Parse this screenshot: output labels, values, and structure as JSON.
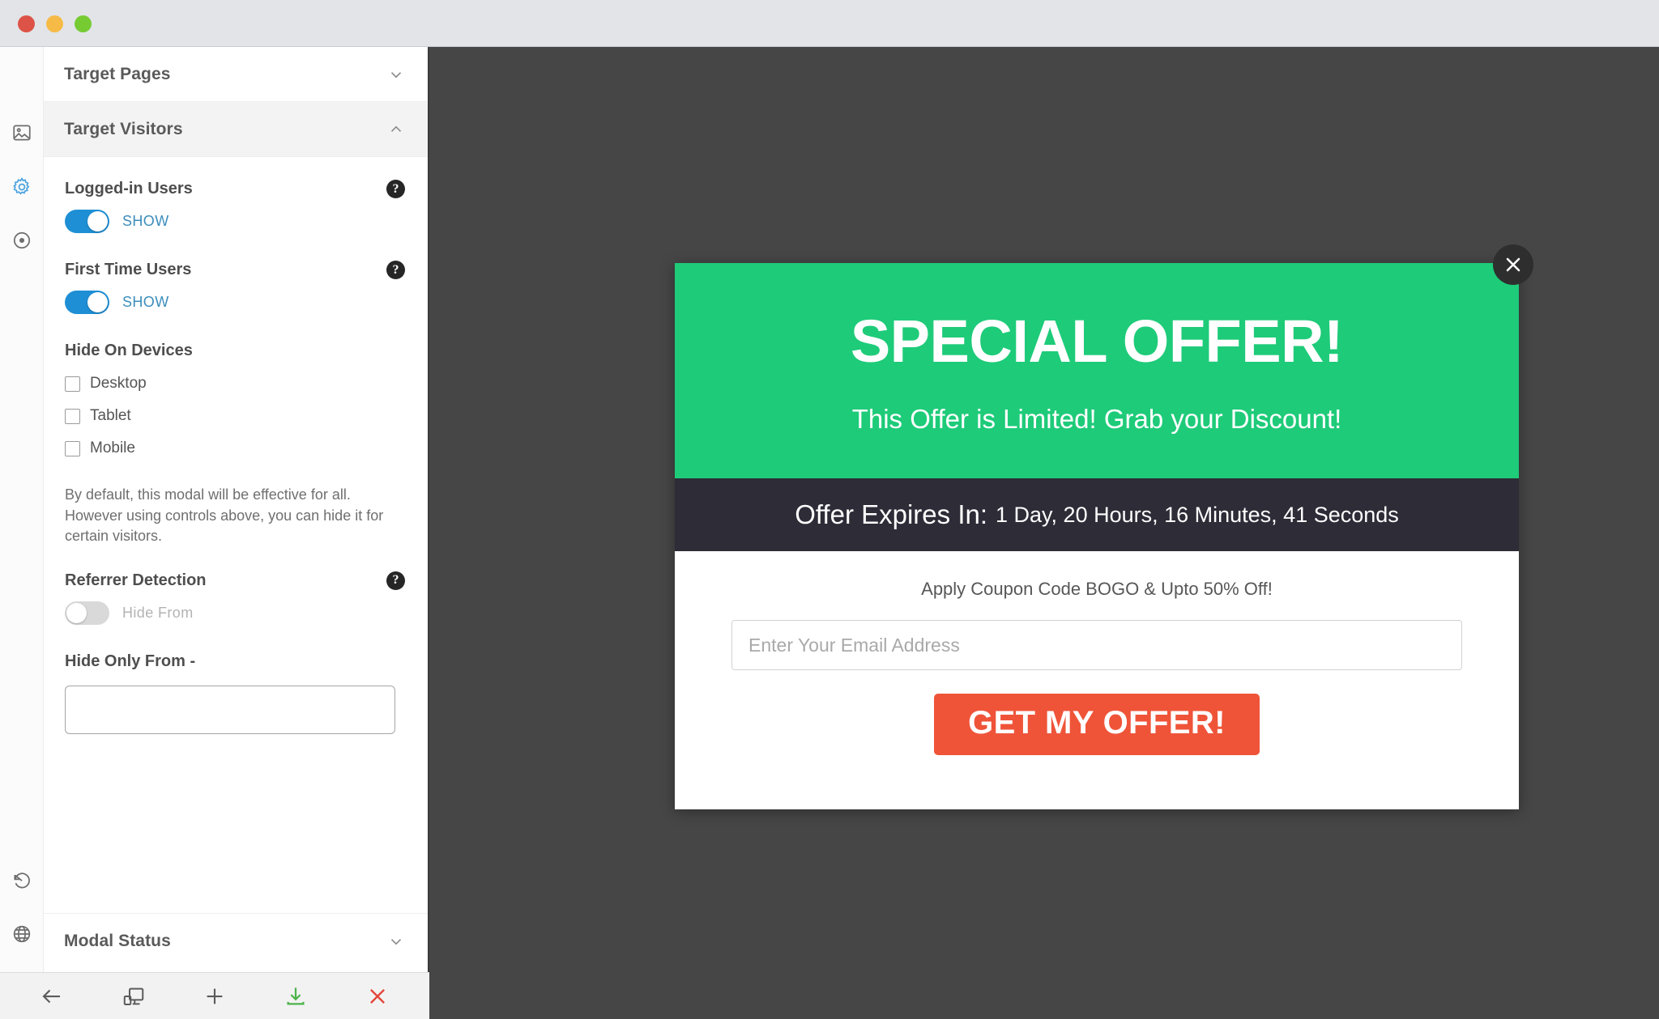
{
  "window": {
    "traffic_lights": [
      {
        "name": "close",
        "color": "#dd5347"
      },
      {
        "name": "minimize",
        "color": "#f6bb47"
      },
      {
        "name": "maximize",
        "color": "#76cb33"
      }
    ]
  },
  "rail": {
    "items": [
      {
        "icon": "image-icon",
        "name": "rail-image",
        "active": false
      },
      {
        "icon": "gear-icon",
        "name": "rail-gear",
        "active": true
      },
      {
        "icon": "target-icon",
        "name": "rail-target",
        "active": false
      },
      {
        "icon": "history-icon",
        "name": "rail-history",
        "active": false
      },
      {
        "icon": "globe-icon",
        "name": "rail-globe",
        "active": false
      }
    ]
  },
  "sidebar": {
    "sections": {
      "target_pages": {
        "title": "Target Pages",
        "state": "collapsed",
        "chevron": "chevron-down-icon"
      },
      "target_visitors": {
        "title": "Target Visitors",
        "state": "expanded",
        "chevron": "chevron-up-icon"
      },
      "modal_status": {
        "title": "Modal Status",
        "state": "collapsed",
        "chevron": "chevron-down-icon"
      }
    },
    "logged_in_users": {
      "label": "Logged-in Users",
      "toggle_state": "on",
      "toggle_label": "SHOW",
      "help": "?"
    },
    "first_time_users": {
      "label": "First Time Users",
      "toggle_state": "on",
      "toggle_label": "SHOW",
      "help": "?"
    },
    "hide_on_devices": {
      "label": "Hide On Devices",
      "options": [
        {
          "label": "Desktop",
          "checked": false
        },
        {
          "label": "Tablet",
          "checked": false
        },
        {
          "label": "Mobile",
          "checked": false
        }
      ]
    },
    "note": "By default, this modal will be effective for all. However using controls above, you can hide it for certain visitors.",
    "referrer_detection": {
      "label": "Referrer Detection",
      "toggle_state": "off",
      "toggle_label": "Hide From",
      "help": "?"
    },
    "hide_only_from": {
      "label": "Hide Only From -",
      "value": "",
      "placeholder": ""
    }
  },
  "toolbar": {
    "buttons": [
      {
        "name": "back-button",
        "icon": "arrow-left-icon",
        "color": "#5b5b5b"
      },
      {
        "name": "responsive-preview-button",
        "icon": "devices-icon",
        "color": "#5b5b5b"
      },
      {
        "name": "add-button",
        "icon": "plus-icon",
        "color": "#5b5b5b"
      },
      {
        "name": "save-download-button",
        "icon": "download-icon",
        "color": "#4bb34b"
      },
      {
        "name": "close-button",
        "icon": "close-x-icon",
        "color": "#e3453a"
      }
    ]
  },
  "modal": {
    "title": "SPECIAL OFFER!",
    "subtitle": "This Offer is Limited! Grab your Discount!",
    "timer_label": "Offer Expires In:",
    "timer_value": "1 Day, 20 Hours, 16 Minutes, 41 Seconds",
    "coupon_text": "Apply Coupon Code BOGO & Upto 50% Off!",
    "email_value": "",
    "email_placeholder": "Enter Your Email Address",
    "cta_label": "GET MY OFFER!",
    "close_icon": "close-x-icon",
    "colors": {
      "header_green": "#1ecb79",
      "timer_dark": "#2d2c37",
      "cta_red": "#ef5439",
      "canvas": "#464646"
    }
  }
}
